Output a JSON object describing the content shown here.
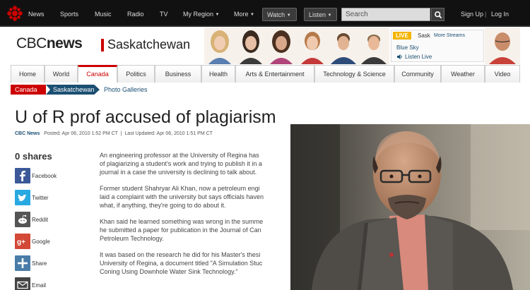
{
  "topbar": {
    "items": [
      {
        "label": "News"
      },
      {
        "label": "Sports"
      },
      {
        "label": "Music"
      },
      {
        "label": "Radio"
      },
      {
        "label": "TV"
      },
      {
        "label": "My Region"
      },
      {
        "label": "More"
      }
    ],
    "watch_label": "Watch",
    "listen_label": "Listen",
    "search_placeholder": "Search",
    "signup_label": "Sign Up",
    "divider": "|",
    "login_label": "Log In",
    "logo_icon": "cbc-gem-icon"
  },
  "header": {
    "brand_cbc": "CBC",
    "brand_news": "news",
    "region": "Saskatchewan",
    "live": {
      "tag": "LIVE",
      "station": "Sask",
      "more_streams": "More Streams",
      "show": "Blue Sky",
      "listen_now": "Listen Live"
    }
  },
  "nav": {
    "tabs": [
      {
        "label": "Home"
      },
      {
        "label": "World"
      },
      {
        "label": "Canada"
      },
      {
        "label": "Politics"
      },
      {
        "label": "Business"
      },
      {
        "label": "Health"
      },
      {
        "label": "Arts & Entertainment"
      },
      {
        "label": "Technology & Science"
      },
      {
        "label": "Community"
      },
      {
        "label": "Weather"
      },
      {
        "label": "Video"
      }
    ],
    "active": "Canada"
  },
  "breadcrumb": {
    "items": [
      {
        "label": "Canada"
      },
      {
        "label": "Saskatchewan"
      }
    ],
    "extra": "Photo Galleries"
  },
  "article": {
    "headline": "U of R prof accused of plagiarism",
    "source": "CBC News",
    "posted": "Posted: Apr 06, 2010 1:52 PM CT",
    "updated": "Last Updated: Apr 06, 2010 1:51 PM CT",
    "paragraphs": [
      {
        "lines": [
          "An engineering professor at the University of Regina has",
          "of plagiarizing a student's work and trying to publish it in a",
          "journal in a case the university is declining to talk about."
        ]
      },
      {
        "lines": [
          "Former student Shahryar Ali Khan, now a petroleum engi",
          "laid a complaint with the university but says officials haven",
          "what, if anything, they're going to do about it."
        ]
      },
      {
        "lines": [
          "Khan said he learned something was wrong in the summe",
          "he submitted a paper for publication in the Journal of Can",
          "Petroleum Technology."
        ]
      },
      {
        "lines": [
          "It was based on the research he did for his Master's thesi",
          "University of Regina, a document titled \"A Simulation Stuc",
          "Coning Using Downhole Water Sink Technology.\""
        ]
      }
    ]
  },
  "share": {
    "count_label": "0 shares",
    "items": [
      {
        "label": "Facebook",
        "icon": "facebook-icon",
        "color": "#3b5998"
      },
      {
        "label": "Twitter",
        "icon": "twitter-icon",
        "color": "#29a9e1"
      },
      {
        "label": "Reddit",
        "icon": "reddit-icon",
        "color": "#555555"
      },
      {
        "label": "Google",
        "icon": "google-plus-icon",
        "color": "#d34836"
      },
      {
        "label": "Share",
        "icon": "share-plus-icon",
        "color": "#4a7ca8"
      },
      {
        "label": "Email",
        "icon": "email-icon",
        "color": "#444444"
      }
    ]
  },
  "colors": {
    "accent": "#cc0000",
    "topbar": "#111111",
    "crumb_blue": "#1b4f72"
  }
}
